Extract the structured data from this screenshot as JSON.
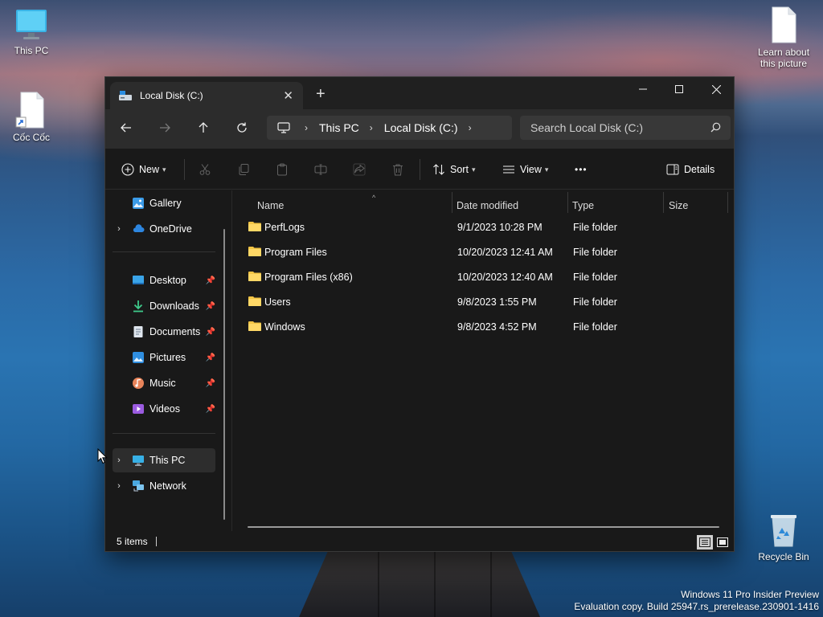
{
  "desktop": {
    "icons": [
      {
        "label": "This PC",
        "icon": "monitor-icon"
      },
      {
        "label": "Cốc Cốc",
        "icon": "shortcut-file-icon"
      },
      {
        "label": "Learn about this picture",
        "icon": "file-icon"
      },
      {
        "label": "Recycle Bin",
        "icon": "recycle-bin-icon"
      }
    ],
    "watermark": {
      "line1": "Windows 11 Pro Insider Preview",
      "line2": "Evaluation copy. Build 25947.rs_prerelease.230901-1416"
    }
  },
  "window": {
    "tab_title": "Local Disk (C:)",
    "tab_close": "✕",
    "new_tab": "+",
    "controls": {
      "minimize": "—",
      "maximize": "☐",
      "close": "✕"
    }
  },
  "nav": {
    "back": "←",
    "forward": "→",
    "up": "↑",
    "refresh": "↻",
    "breadcrumb": [
      "This PC",
      "Local Disk (C:)"
    ],
    "search_placeholder": "Search Local Disk (C:)"
  },
  "toolbar": {
    "new_label": "New",
    "sort_label": "Sort",
    "view_label": "View",
    "more_label": "•••",
    "details_label": "Details"
  },
  "sidebar": {
    "items": [
      {
        "label": "Gallery",
        "icon": "gallery-icon",
        "expand": ""
      },
      {
        "label": "OneDrive",
        "icon": "cloud-icon",
        "expand": "›"
      },
      {
        "label": "Desktop",
        "icon": "desktop-icon",
        "pinned": true
      },
      {
        "label": "Downloads",
        "icon": "download-icon",
        "pinned": true
      },
      {
        "label": "Documents",
        "icon": "documents-icon",
        "pinned": true
      },
      {
        "label": "Pictures",
        "icon": "pictures-icon",
        "pinned": true
      },
      {
        "label": "Music",
        "icon": "music-icon",
        "pinned": true
      },
      {
        "label": "Videos",
        "icon": "videos-icon",
        "pinned": true
      },
      {
        "label": "This PC",
        "icon": "monitor-icon",
        "expand": "›"
      },
      {
        "label": "Network",
        "icon": "network-icon",
        "expand": "›"
      }
    ]
  },
  "columns": [
    "Name",
    "Date modified",
    "Type",
    "Size"
  ],
  "files": [
    {
      "name": "PerfLogs",
      "date": "9/1/2023 10:28 PM",
      "type": "File folder",
      "size": ""
    },
    {
      "name": "Program Files",
      "date": "10/20/2023 12:41 AM",
      "type": "File folder",
      "size": ""
    },
    {
      "name": "Program Files (x86)",
      "date": "10/20/2023 12:40 AM",
      "type": "File folder",
      "size": ""
    },
    {
      "name": "Users",
      "date": "9/8/2023 1:55 PM",
      "type": "File folder",
      "size": ""
    },
    {
      "name": "Windows",
      "date": "9/8/2023 4:52 PM",
      "type": "File folder",
      "size": ""
    }
  ],
  "status": {
    "item_count": "5 items"
  },
  "colors": {
    "accent": "#4cc2ff",
    "folder": "#f4c545",
    "window_bg": "#191919",
    "navbar_bg": "#2c2c2c"
  }
}
